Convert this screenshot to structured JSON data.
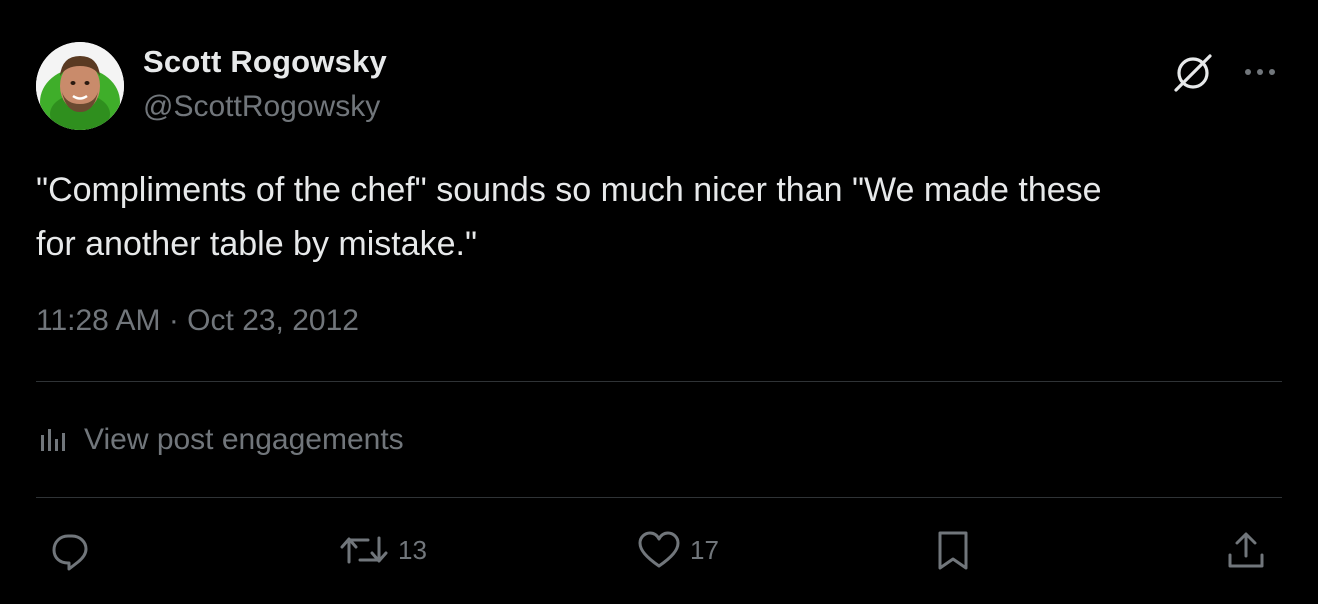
{
  "author": {
    "display_name": "Scott Rogowsky",
    "handle": "@ScottRogowsky",
    "avatar_icon": "avatar-photo"
  },
  "header_actions": {
    "grok_icon": "grok-icon",
    "more_icon": "more-options-icon"
  },
  "tweet": {
    "text": "\"Compliments of the chef\" sounds so much nicer than \"We made these\nfor another table by mistake.\"",
    "timestamp": "11:28 AM · Oct 23, 2012"
  },
  "engagements": {
    "label": "View post engagements",
    "icon": "analytics-icon"
  },
  "actions": {
    "reply": {
      "icon": "reply-icon",
      "count": ""
    },
    "repost": {
      "icon": "repost-icon",
      "count": "13"
    },
    "like": {
      "icon": "like-icon",
      "count": "17"
    },
    "bookmark": {
      "icon": "bookmark-icon",
      "count": ""
    },
    "share": {
      "icon": "share-icon",
      "count": ""
    }
  },
  "colors": {
    "background": "#000000",
    "primary_text": "#e7e9ea",
    "secondary_text": "#71767b",
    "divider": "#2f3336"
  }
}
